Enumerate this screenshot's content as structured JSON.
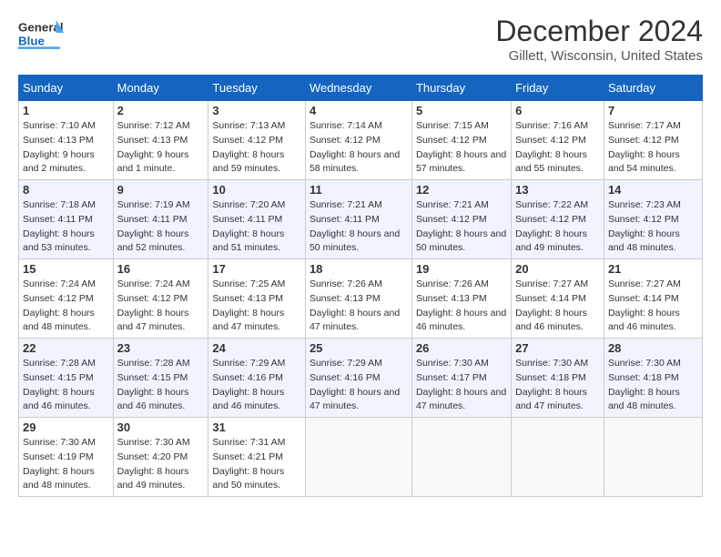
{
  "header": {
    "logo_top": "General",
    "logo_bottom": "Blue",
    "title": "December 2024",
    "location": "Gillett, Wisconsin, United States"
  },
  "columns": [
    "Sunday",
    "Monday",
    "Tuesday",
    "Wednesday",
    "Thursday",
    "Friday",
    "Saturday"
  ],
  "weeks": [
    [
      {
        "day": "1",
        "sunrise": "Sunrise: 7:10 AM",
        "sunset": "Sunset: 4:13 PM",
        "daylight": "Daylight: 9 hours and 2 minutes."
      },
      {
        "day": "2",
        "sunrise": "Sunrise: 7:12 AM",
        "sunset": "Sunset: 4:13 PM",
        "daylight": "Daylight: 9 hours and 1 minute."
      },
      {
        "day": "3",
        "sunrise": "Sunrise: 7:13 AM",
        "sunset": "Sunset: 4:12 PM",
        "daylight": "Daylight: 8 hours and 59 minutes."
      },
      {
        "day": "4",
        "sunrise": "Sunrise: 7:14 AM",
        "sunset": "Sunset: 4:12 PM",
        "daylight": "Daylight: 8 hours and 58 minutes."
      },
      {
        "day": "5",
        "sunrise": "Sunrise: 7:15 AM",
        "sunset": "Sunset: 4:12 PM",
        "daylight": "Daylight: 8 hours and 57 minutes."
      },
      {
        "day": "6",
        "sunrise": "Sunrise: 7:16 AM",
        "sunset": "Sunset: 4:12 PM",
        "daylight": "Daylight: 8 hours and 55 minutes."
      },
      {
        "day": "7",
        "sunrise": "Sunrise: 7:17 AM",
        "sunset": "Sunset: 4:12 PM",
        "daylight": "Daylight: 8 hours and 54 minutes."
      }
    ],
    [
      {
        "day": "8",
        "sunrise": "Sunrise: 7:18 AM",
        "sunset": "Sunset: 4:11 PM",
        "daylight": "Daylight: 8 hours and 53 minutes."
      },
      {
        "day": "9",
        "sunrise": "Sunrise: 7:19 AM",
        "sunset": "Sunset: 4:11 PM",
        "daylight": "Daylight: 8 hours and 52 minutes."
      },
      {
        "day": "10",
        "sunrise": "Sunrise: 7:20 AM",
        "sunset": "Sunset: 4:11 PM",
        "daylight": "Daylight: 8 hours and 51 minutes."
      },
      {
        "day": "11",
        "sunrise": "Sunrise: 7:21 AM",
        "sunset": "Sunset: 4:11 PM",
        "daylight": "Daylight: 8 hours and 50 minutes."
      },
      {
        "day": "12",
        "sunrise": "Sunrise: 7:21 AM",
        "sunset": "Sunset: 4:12 PM",
        "daylight": "Daylight: 8 hours and 50 minutes."
      },
      {
        "day": "13",
        "sunrise": "Sunrise: 7:22 AM",
        "sunset": "Sunset: 4:12 PM",
        "daylight": "Daylight: 8 hours and 49 minutes."
      },
      {
        "day": "14",
        "sunrise": "Sunrise: 7:23 AM",
        "sunset": "Sunset: 4:12 PM",
        "daylight": "Daylight: 8 hours and 48 minutes."
      }
    ],
    [
      {
        "day": "15",
        "sunrise": "Sunrise: 7:24 AM",
        "sunset": "Sunset: 4:12 PM",
        "daylight": "Daylight: 8 hours and 48 minutes."
      },
      {
        "day": "16",
        "sunrise": "Sunrise: 7:24 AM",
        "sunset": "Sunset: 4:12 PM",
        "daylight": "Daylight: 8 hours and 47 minutes."
      },
      {
        "day": "17",
        "sunrise": "Sunrise: 7:25 AM",
        "sunset": "Sunset: 4:13 PM",
        "daylight": "Daylight: 8 hours and 47 minutes."
      },
      {
        "day": "18",
        "sunrise": "Sunrise: 7:26 AM",
        "sunset": "Sunset: 4:13 PM",
        "daylight": "Daylight: 8 hours and 47 minutes."
      },
      {
        "day": "19",
        "sunrise": "Sunrise: 7:26 AM",
        "sunset": "Sunset: 4:13 PM",
        "daylight": "Daylight: 8 hours and 46 minutes."
      },
      {
        "day": "20",
        "sunrise": "Sunrise: 7:27 AM",
        "sunset": "Sunset: 4:14 PM",
        "daylight": "Daylight: 8 hours and 46 minutes."
      },
      {
        "day": "21",
        "sunrise": "Sunrise: 7:27 AM",
        "sunset": "Sunset: 4:14 PM",
        "daylight": "Daylight: 8 hours and 46 minutes."
      }
    ],
    [
      {
        "day": "22",
        "sunrise": "Sunrise: 7:28 AM",
        "sunset": "Sunset: 4:15 PM",
        "daylight": "Daylight: 8 hours and 46 minutes."
      },
      {
        "day": "23",
        "sunrise": "Sunrise: 7:28 AM",
        "sunset": "Sunset: 4:15 PM",
        "daylight": "Daylight: 8 hours and 46 minutes."
      },
      {
        "day": "24",
        "sunrise": "Sunrise: 7:29 AM",
        "sunset": "Sunset: 4:16 PM",
        "daylight": "Daylight: 8 hours and 46 minutes."
      },
      {
        "day": "25",
        "sunrise": "Sunrise: 7:29 AM",
        "sunset": "Sunset: 4:16 PM",
        "daylight": "Daylight: 8 hours and 47 minutes."
      },
      {
        "day": "26",
        "sunrise": "Sunrise: 7:30 AM",
        "sunset": "Sunset: 4:17 PM",
        "daylight": "Daylight: 8 hours and 47 minutes."
      },
      {
        "day": "27",
        "sunrise": "Sunrise: 7:30 AM",
        "sunset": "Sunset: 4:18 PM",
        "daylight": "Daylight: 8 hours and 47 minutes."
      },
      {
        "day": "28",
        "sunrise": "Sunrise: 7:30 AM",
        "sunset": "Sunset: 4:18 PM",
        "daylight": "Daylight: 8 hours and 48 minutes."
      }
    ],
    [
      {
        "day": "29",
        "sunrise": "Sunrise: 7:30 AM",
        "sunset": "Sunset: 4:19 PM",
        "daylight": "Daylight: 8 hours and 48 minutes."
      },
      {
        "day": "30",
        "sunrise": "Sunrise: 7:30 AM",
        "sunset": "Sunset: 4:20 PM",
        "daylight": "Daylight: 8 hours and 49 minutes."
      },
      {
        "day": "31",
        "sunrise": "Sunrise: 7:31 AM",
        "sunset": "Sunset: 4:21 PM",
        "daylight": "Daylight: 8 hours and 50 minutes."
      },
      null,
      null,
      null,
      null
    ]
  ]
}
